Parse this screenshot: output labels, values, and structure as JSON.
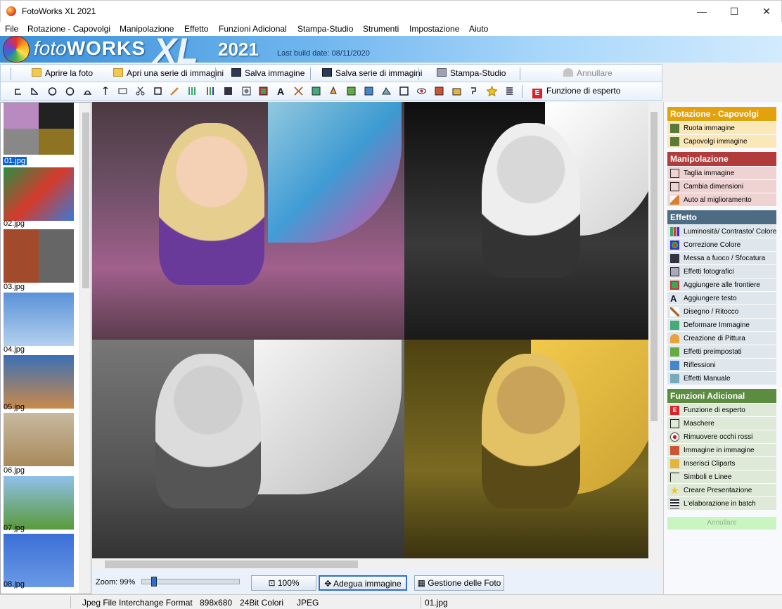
{
  "window": {
    "title": "FotoWorks XL 2021",
    "minimize_glyph": "—",
    "maximize_glyph": "☐",
    "close_glyph": "✕"
  },
  "menu": [
    "File",
    "Rotazione - Capovolgi",
    "Manipolazione",
    "Effetto",
    "Funzioni Adicional",
    "Stampa-Studio",
    "Strumenti",
    "Impostazione",
    "Aiuto"
  ],
  "banner": {
    "logo_prefix": "foto",
    "logo_main": "WORKS",
    "logo_xl": "XL",
    "year": "2021",
    "build": "Last build date: 08/11/2020"
  },
  "toolbar": {
    "open": "Aprire la foto",
    "open_series": "Apri una serie di immagini",
    "save": "Salva immagine",
    "save_series": "Salva serie di immagini",
    "print": "Stampa-Studio",
    "undo": "Annullare",
    "expert": "Funzione di esperto",
    "expert_icon_letter": "E"
  },
  "thumbnails": [
    "01.jpg",
    "02.jpg",
    "03.jpg",
    "04.jpg",
    "05.jpg",
    "06.jpg",
    "07.jpg",
    "08.jpg"
  ],
  "bottom": {
    "zoom": "Zoom: 99%",
    "zoom_level": 0.1,
    "btn_100": "100%",
    "btn_fit": "Adegua immagine",
    "btn_manage": "Gestione delle Foto"
  },
  "panel": {
    "rotazione": {
      "title": "Rotazione - Capovolgi",
      "color": "#e3a20c",
      "items": [
        "Ruota immagine",
        "Capovolgi immagine"
      ]
    },
    "manipolazione": {
      "title": "Manipolazione",
      "color": "#b23b3b",
      "items": [
        "Taglia immagine",
        "Cambia dimensioni",
        "Auto al miglioramento"
      ]
    },
    "effetto": {
      "title": "Effetto",
      "color": "#4d6c84",
      "items": [
        "Luminosità/ Contrasto/ Colore",
        "Correzione Colore",
        "Messa a fuoco / Sfocatura",
        "Effetti fotografici",
        "Aggiungere alle frontiere",
        "Aggiungere testo",
        "Disegno / Ritocco",
        "Deformare Immagine",
        "Creazione di Pittura",
        "Effetti preimpostati",
        "Riflessioni",
        "Effetti Manuale"
      ]
    },
    "funzioni": {
      "title": "Funzioni Adicional",
      "color": "#5b8c3f",
      "items": [
        "Funzione di esperto",
        "Maschere",
        "Rimuovere occhi rossi",
        "Immagine in immagine",
        "Inserisci Cliparts",
        "Simboli e Linee",
        "Creare Presentazione",
        "L'elaborazione in batch"
      ]
    },
    "annullare": "Annullare"
  },
  "status": {
    "format": "Jpeg File Interchange Format",
    "dims": "898x680",
    "depth": "24Bit Colori",
    "type": "JPEG",
    "file": "01.jpg"
  }
}
